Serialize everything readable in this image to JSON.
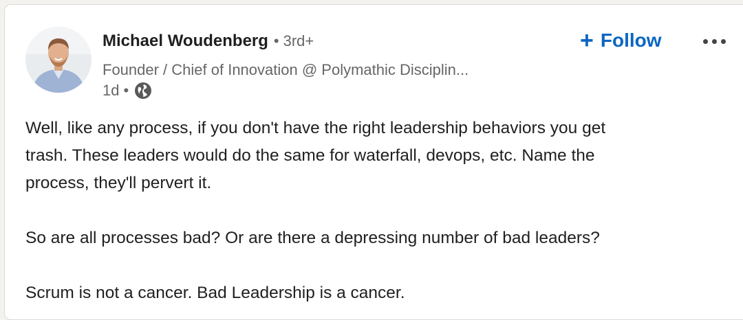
{
  "post": {
    "author": {
      "name": "Michael Woudenberg",
      "separator": "•",
      "degree": "3rd+",
      "headline": "Founder / Chief of Innovation @ Polymathic Disciplin...",
      "time": "1d",
      "time_separator": "•",
      "visibility_icon": "globe-icon",
      "avatar_icon": "avatar-photo"
    },
    "follow": {
      "plus": "+",
      "label": "Follow",
      "color": "#0a66c2"
    },
    "more_icon": "ellipsis-icon",
    "body": {
      "paragraph_1_line_1": "Well, like any process, if you don't have the right leadership behaviors you get",
      "paragraph_1_line_2": "trash. These leaders would do the same for waterfall, devops, etc. Name the",
      "paragraph_1_line_3": "process, they'll pervert it.",
      "paragraph_2": "So are all processes bad? Or are there a depressing number of bad leaders?",
      "paragraph_3": "Scrum is not a cancer. Bad Leadership is a cancer."
    }
  }
}
